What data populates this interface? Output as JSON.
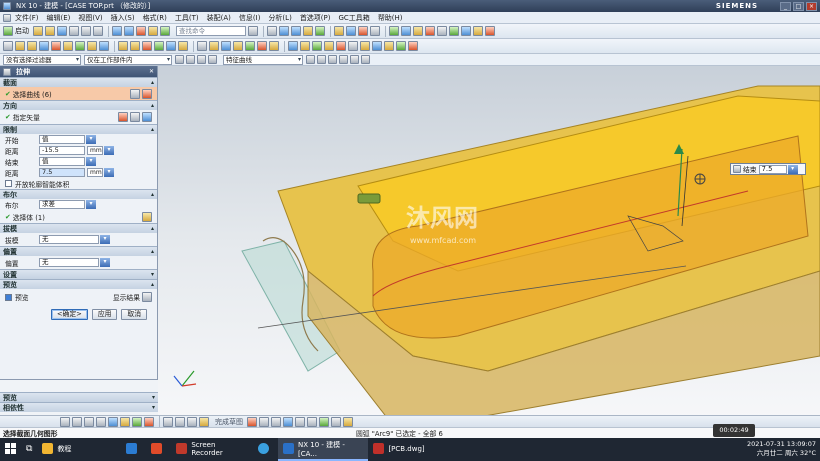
{
  "window": {
    "title": "NX 10 - 建模 - [CASE TOP.prt （修改的）]",
    "brand": "SIEMENS",
    "controls": [
      "_",
      "□",
      "×"
    ]
  },
  "menu": [
    "文件(F)",
    "编辑(E)",
    "视图(V)",
    "插入(S)",
    "格式(R)",
    "工具(T)",
    "装配(A)",
    "信息(I)",
    "分析(L)",
    "首选项(P)",
    "GC工具箱",
    "帮助(H)"
  ],
  "toolbar": {
    "start_label": "启动",
    "search_placeholder": "查找命令"
  },
  "selection_bar": {
    "filter": "没有选择过滤器",
    "scope": "仅在工作部件内",
    "curve_rule": "特征曲线"
  },
  "dialog": {
    "title": "拉伸",
    "sections": {
      "section": {
        "label": "截面",
        "select_curve": "选择曲线 (6)"
      },
      "direction": {
        "label": "方向",
        "specify_vector": "指定矢量"
      },
      "limits": {
        "label": "限制",
        "start_label": "开始",
        "start_value": "值",
        "distance_label": "距离",
        "start_distance": "-15.5",
        "start_unit": "mm",
        "end_label": "结束",
        "end_value": "值",
        "end_distance_label": "距离",
        "end_distance": "7.5",
        "end_unit": "mm",
        "open_profile": "开放轮廓智能体积"
      },
      "boolean": {
        "label": "布尔",
        "boolean_label": "布尔",
        "boolean_value": "求差",
        "select_body": "选择体 (1)"
      },
      "draft": {
        "label": "拔模",
        "draft_label": "拔模",
        "draft_value": "无"
      },
      "offset": {
        "label": "偏置",
        "offset_label": "偏置",
        "offset_value": "无"
      },
      "settings": {
        "label": "设置"
      },
      "preview": {
        "label": "预览",
        "preview_label": "预览",
        "show_result": "显示结果"
      }
    },
    "buttons": {
      "ok": "<确定>",
      "apply": "应用",
      "cancel": "取消"
    }
  },
  "nav_panel": {
    "preview_label": "预览",
    "dependency_label": "相依性"
  },
  "float_dialog": {
    "label": "结束",
    "value": "7.5"
  },
  "watermark": {
    "text": "沐风网",
    "url": "www.mfcad.com"
  },
  "bottom_toolbar": {
    "curve_label": "完成草图"
  },
  "status": {
    "left": "选择截面几何图形",
    "middle": "圆弧 \"Arc9\" 已选定 - 全部 6"
  },
  "taskbar": {
    "items": [
      {
        "label": "教程",
        "color": "#f2b632"
      },
      {
        "label": "",
        "color": "#2b7cd3"
      },
      {
        "label": "",
        "color": "#e04b2a"
      },
      {
        "label": "Screen Recorder",
        "color": "#c0392b"
      },
      {
        "label": "",
        "color": "#3aa0e0"
      },
      {
        "label": "NX 10 - 建模 - [CA...",
        "color": "#2a70c7"
      },
      {
        "label": "[PCB.dwg]",
        "color": "#c0302a"
      }
    ],
    "clock_time": "2021-07-31 13:09:07",
    "clock_date": "六月廿二 周六 32°C",
    "recorder_time": "00:02:49"
  }
}
